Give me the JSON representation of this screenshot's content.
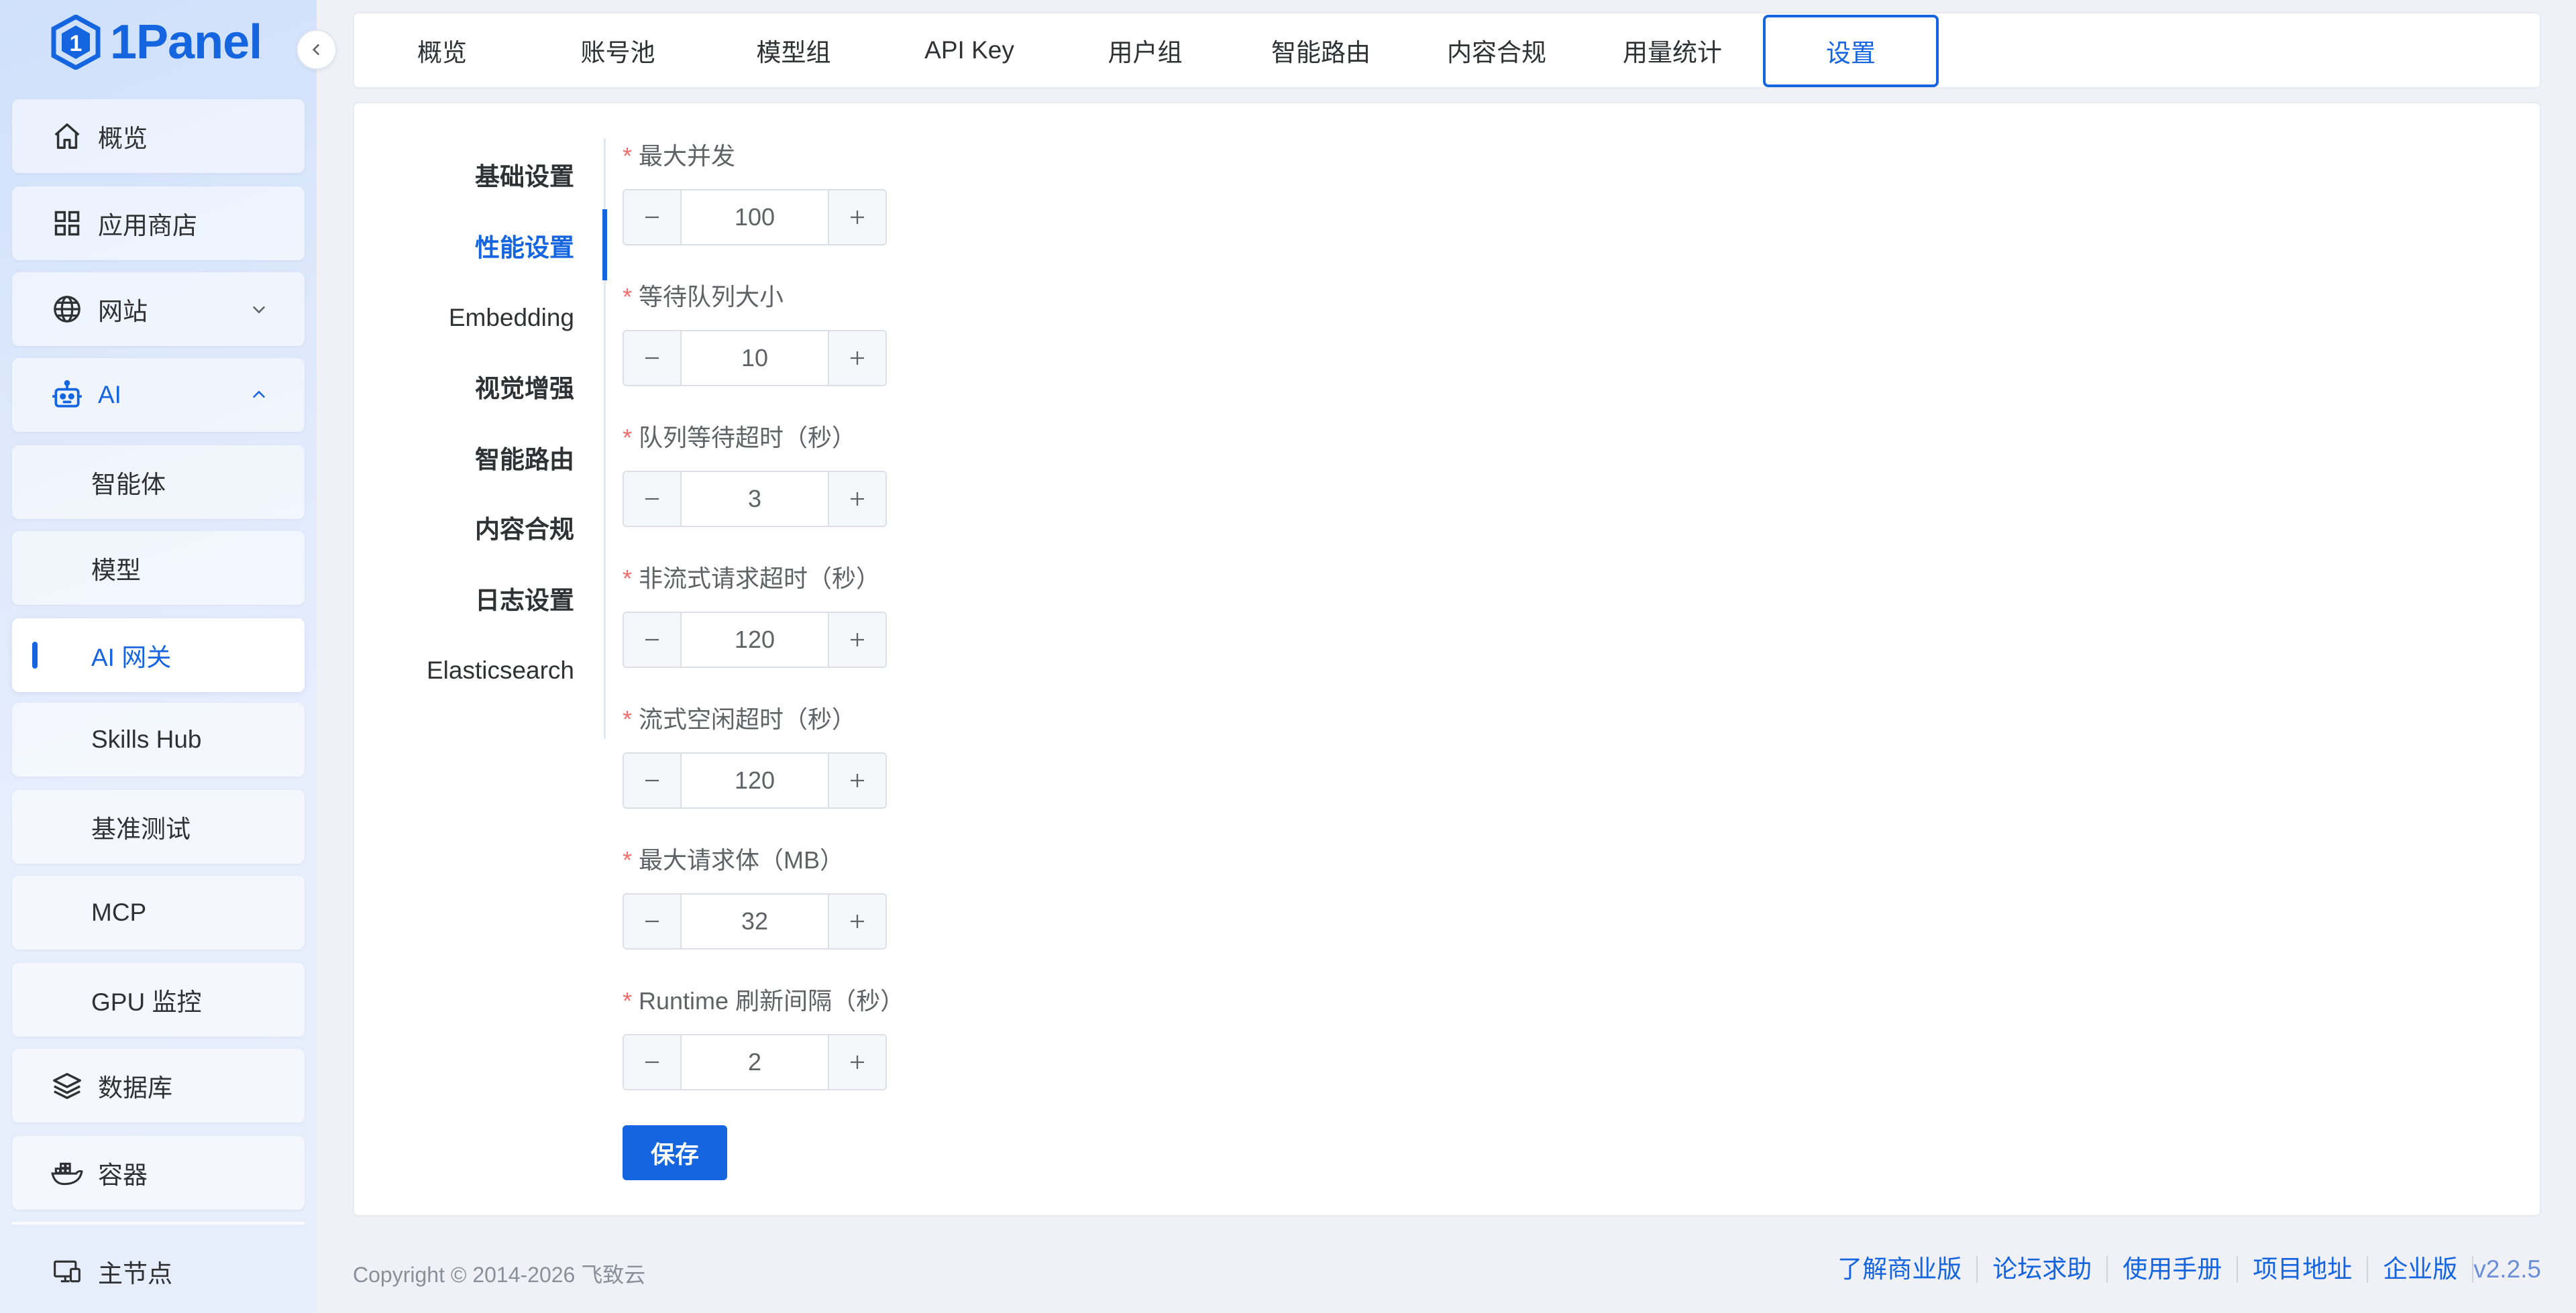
{
  "brand": {
    "name": "1Panel",
    "color": "#1565e0"
  },
  "sidebar": {
    "items": [
      {
        "label": "概览",
        "icon": "home-icon"
      },
      {
        "label": "应用商店",
        "icon": "grid-icon"
      },
      {
        "label": "网站",
        "icon": "globe-icon"
      },
      {
        "label": "AI",
        "icon": "robot-icon"
      },
      {
        "label": "智能体"
      },
      {
        "label": "模型"
      },
      {
        "label": "AI 网关"
      },
      {
        "label": "Skills Hub"
      },
      {
        "label": "基准测试"
      },
      {
        "label": "MCP"
      },
      {
        "label": "GPU 监控"
      },
      {
        "label": "数据库",
        "icon": "layers-icon"
      },
      {
        "label": "容器",
        "icon": "docker-icon"
      }
    ],
    "bottom_node": {
      "label": "主节点",
      "icon": "monitor-icon"
    },
    "active": "AI 网关"
  },
  "tabs": [
    "概览",
    "账号池",
    "模型组",
    "API Key",
    "用户组",
    "智能路由",
    "内容合规",
    "用量统计",
    "设置"
  ],
  "active_tab": "设置",
  "subnav": [
    "基础设置",
    "性能设置",
    "Embedding",
    "视觉增强",
    "智能路由",
    "内容合规",
    "日志设置",
    "Elasticsearch"
  ],
  "active_subnav": "性能设置",
  "form": {
    "fields": [
      {
        "label": "最大并发",
        "value": "100"
      },
      {
        "label": "等待队列大小",
        "value": "10"
      },
      {
        "label": "队列等待超时（秒）",
        "value": "3"
      },
      {
        "label": "非流式请求超时（秒）",
        "value": "120"
      },
      {
        "label": "流式空闲超时（秒）",
        "value": "120"
      },
      {
        "label": "最大请求体（MB）",
        "value": "32"
      },
      {
        "label": "Runtime 刷新间隔（秒）",
        "value": "2"
      }
    ],
    "required_mark": "*",
    "save_label": "保存"
  },
  "footer": {
    "copyright": "Copyright © 2014-2026 飞致云",
    "links": [
      "了解商业版",
      "论坛求助",
      "使用手册",
      "项目地址",
      "企业版"
    ],
    "version": "v2.2.5"
  }
}
